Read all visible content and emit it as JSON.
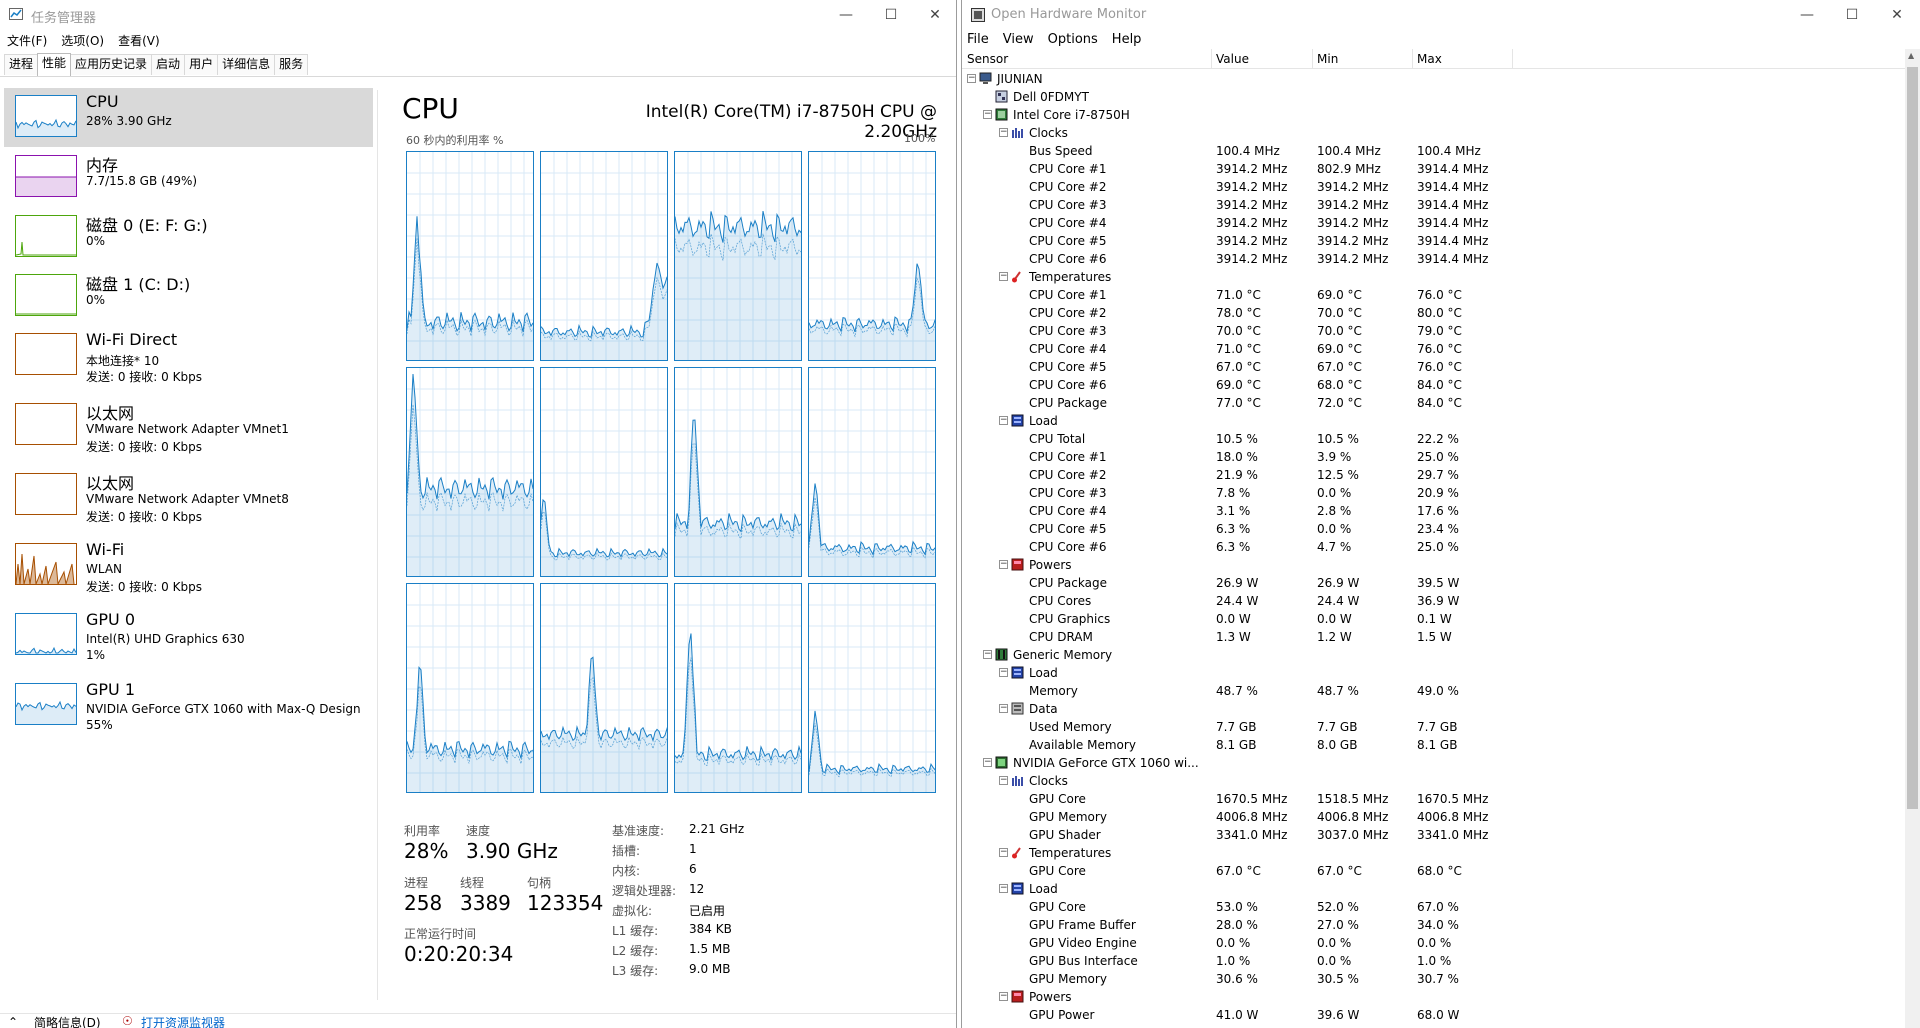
{
  "taskmgr": {
    "title": "任务管理器",
    "menu": [
      "文件(F)",
      "选项(O)",
      "查看(V)"
    ],
    "tabs": [
      "进程",
      "性能",
      "应用历史记录",
      "启动",
      "用户",
      "详细信息",
      "服务"
    ],
    "active_tab": "性能",
    "sidebar": [
      {
        "title": "CPU",
        "l1": "28% 3.90 GHz",
        "l2": "",
        "color": "#1a7fc6",
        "sel": true
      },
      {
        "title": "内存",
        "l1": "7.7/15.8 GB (49%)",
        "l2": "",
        "color": "#8b12ae"
      },
      {
        "title": "磁盘 0 (E: F: G:)",
        "l1": "0%",
        "l2": "",
        "color": "#4da60c"
      },
      {
        "title": "磁盘 1 (C: D:)",
        "l1": "0%",
        "l2": "",
        "color": "#4da60c"
      },
      {
        "title": "Wi-Fi Direct",
        "l1": "本地连接* 10",
        "l2": "发送: 0 接收: 0 Kbps",
        "color": "#a74f01"
      },
      {
        "title": "以太网",
        "l1": "VMware Network Adapter VMnet1",
        "l2": "发送: 0 接收: 0 Kbps",
        "color": "#a74f01"
      },
      {
        "title": "以太网",
        "l1": "VMware Network Adapter VMnet8",
        "l2": "发送: 0 接收: 0 Kbps",
        "color": "#a74f01"
      },
      {
        "title": "Wi-Fi",
        "l1": "WLAN",
        "l2": "发送: 0 接收: 0 Kbps",
        "color": "#a74f01"
      },
      {
        "title": "GPU 0",
        "l1": "Intel(R) UHD Graphics 630",
        "l2": "1%",
        "color": "#1a7fc6"
      },
      {
        "title": "GPU 1",
        "l1": "NVIDIA GeForce GTX 1060 with Max-Q Design",
        "l2": "55%",
        "color": "#1a7fc6"
      }
    ],
    "cpu_title": "CPU",
    "cpu_model": "Intel(R) Core(TM) i7-8750H CPU @ 2.20GHz",
    "util_label": "60 秒内的利用率 %",
    "util_max": "100%",
    "stats": {
      "util_label": "利用率",
      "util": "28%",
      "speed_label": "速度",
      "speed": "3.90 GHz",
      "proc_label": "进程",
      "proc": "258",
      "thread_label": "线程",
      "thread": "3389",
      "handle_label": "句柄",
      "handle": "123354",
      "uptime_label": "正常运行时间",
      "uptime": "0:20:20:34"
    },
    "right_stats": [
      [
        "基准速度:",
        "2.21 GHz"
      ],
      [
        "插槽:",
        "1"
      ],
      [
        "内核:",
        "6"
      ],
      [
        "逻辑处理器:",
        "12"
      ],
      [
        "虚拟化:",
        "已启用"
      ],
      [
        "L1 缓存:",
        "384 KB"
      ],
      [
        "L2 缓存:",
        "1.5 MB"
      ],
      [
        "L3 缓存:",
        "9.0 MB"
      ]
    ],
    "bottom": {
      "less": "简略信息(D)",
      "resmon": "打开资源监视器"
    }
  },
  "ohm": {
    "title": "Open Hardware Monitor",
    "menu": [
      "File",
      "View",
      "Options",
      "Help"
    ],
    "columns": [
      "Sensor",
      "Value",
      "Min",
      "Max"
    ],
    "rows": [
      {
        "l": 0,
        "n": "JIUNIAN",
        "ic": "pc",
        "exp": "-"
      },
      {
        "l": 1,
        "n": "Dell 0FDMYT",
        "ic": "mb"
      },
      {
        "l": 1,
        "n": "Intel Core i7-8750H",
        "ic": "cpu",
        "exp": "-"
      },
      {
        "l": 2,
        "n": "Clocks",
        "ic": "clk",
        "exp": "-"
      },
      {
        "l": 3,
        "n": "Bus Speed",
        "v": "100.4 MHz",
        "mn": "100.4 MHz",
        "mx": "100.4 MHz"
      },
      {
        "l": 3,
        "n": "CPU Core #1",
        "v": "3914.2 MHz",
        "mn": "802.9 MHz",
        "mx": "3914.4 MHz"
      },
      {
        "l": 3,
        "n": "CPU Core #2",
        "v": "3914.2 MHz",
        "mn": "3914.2 MHz",
        "mx": "3914.4 MHz"
      },
      {
        "l": 3,
        "n": "CPU Core #3",
        "v": "3914.2 MHz",
        "mn": "3914.2 MHz",
        "mx": "3914.4 MHz"
      },
      {
        "l": 3,
        "n": "CPU Core #4",
        "v": "3914.2 MHz",
        "mn": "3914.2 MHz",
        "mx": "3914.4 MHz"
      },
      {
        "l": 3,
        "n": "CPU Core #5",
        "v": "3914.2 MHz",
        "mn": "3914.2 MHz",
        "mx": "3914.4 MHz"
      },
      {
        "l": 3,
        "n": "CPU Core #6",
        "v": "3914.2 MHz",
        "mn": "3914.2 MHz",
        "mx": "3914.4 MHz"
      },
      {
        "l": 2,
        "n": "Temperatures",
        "ic": "tmp",
        "exp": "-"
      },
      {
        "l": 3,
        "n": "CPU Core #1",
        "v": "71.0 °C",
        "mn": "69.0 °C",
        "mx": "76.0 °C"
      },
      {
        "l": 3,
        "n": "CPU Core #2",
        "v": "78.0 °C",
        "mn": "70.0 °C",
        "mx": "80.0 °C"
      },
      {
        "l": 3,
        "n": "CPU Core #3",
        "v": "70.0 °C",
        "mn": "70.0 °C",
        "mx": "79.0 °C"
      },
      {
        "l": 3,
        "n": "CPU Core #4",
        "v": "71.0 °C",
        "mn": "69.0 °C",
        "mx": "76.0 °C"
      },
      {
        "l": 3,
        "n": "CPU Core #5",
        "v": "67.0 °C",
        "mn": "67.0 °C",
        "mx": "76.0 °C"
      },
      {
        "l": 3,
        "n": "CPU Core #6",
        "v": "69.0 °C",
        "mn": "68.0 °C",
        "mx": "84.0 °C"
      },
      {
        "l": 3,
        "n": "CPU Package",
        "v": "77.0 °C",
        "mn": "72.0 °C",
        "mx": "84.0 °C"
      },
      {
        "l": 2,
        "n": "Load",
        "ic": "load",
        "exp": "-"
      },
      {
        "l": 3,
        "n": "CPU Total",
        "v": "10.5 %",
        "mn": "10.5 %",
        "mx": "22.2 %"
      },
      {
        "l": 3,
        "n": "CPU Core #1",
        "v": "18.0 %",
        "mn": "3.9 %",
        "mx": "25.0 %"
      },
      {
        "l": 3,
        "n": "CPU Core #2",
        "v": "21.9 %",
        "mn": "12.5 %",
        "mx": "29.7 %"
      },
      {
        "l": 3,
        "n": "CPU Core #3",
        "v": "7.8 %",
        "mn": "0.0 %",
        "mx": "20.9 %"
      },
      {
        "l": 3,
        "n": "CPU Core #4",
        "v": "3.1 %",
        "mn": "2.8 %",
        "mx": "17.6 %"
      },
      {
        "l": 3,
        "n": "CPU Core #5",
        "v": "6.3 %",
        "mn": "0.0 %",
        "mx": "23.4 %"
      },
      {
        "l": 3,
        "n": "CPU Core #6",
        "v": "6.3 %",
        "mn": "4.7 %",
        "mx": "25.0 %"
      },
      {
        "l": 2,
        "n": "Powers",
        "ic": "pwr",
        "exp": "-"
      },
      {
        "l": 3,
        "n": "CPU Package",
        "v": "26.9 W",
        "mn": "26.9 W",
        "mx": "39.5 W"
      },
      {
        "l": 3,
        "n": "CPU Cores",
        "v": "24.4 W",
        "mn": "24.4 W",
        "mx": "36.9 W"
      },
      {
        "l": 3,
        "n": "CPU Graphics",
        "v": "0.0 W",
        "mn": "0.0 W",
        "mx": "0.1 W"
      },
      {
        "l": 3,
        "n": "CPU DRAM",
        "v": "1.3 W",
        "mn": "1.2 W",
        "mx": "1.5 W"
      },
      {
        "l": 1,
        "n": "Generic Memory",
        "ic": "ram",
        "exp": "-"
      },
      {
        "l": 2,
        "n": "Load",
        "ic": "load",
        "exp": "-"
      },
      {
        "l": 3,
        "n": "Memory",
        "v": "48.7 %",
        "mn": "48.7 %",
        "mx": "49.0 %"
      },
      {
        "l": 2,
        "n": "Data",
        "ic": "data",
        "exp": "-"
      },
      {
        "l": 3,
        "n": "Used Memory",
        "v": "7.7 GB",
        "mn": "7.7 GB",
        "mx": "7.7 GB"
      },
      {
        "l": 3,
        "n": "Available Memory",
        "v": "8.1 GB",
        "mn": "8.0 GB",
        "mx": "8.1 GB"
      },
      {
        "l": 1,
        "n": "NVIDIA GeForce GTX 1060 wi...",
        "ic": "gpu",
        "exp": "-"
      },
      {
        "l": 2,
        "n": "Clocks",
        "ic": "clk",
        "exp": "-"
      },
      {
        "l": 3,
        "n": "GPU Core",
        "v": "1670.5 MHz",
        "mn": "1518.5 MHz",
        "mx": "1670.5 MHz"
      },
      {
        "l": 3,
        "n": "GPU Memory",
        "v": "4006.8 MHz",
        "mn": "4006.8 MHz",
        "mx": "4006.8 MHz"
      },
      {
        "l": 3,
        "n": "GPU Shader",
        "v": "3341.0 MHz",
        "mn": "3037.0 MHz",
        "mx": "3341.0 MHz"
      },
      {
        "l": 2,
        "n": "Temperatures",
        "ic": "tmp",
        "exp": "-"
      },
      {
        "l": 3,
        "n": "GPU Core",
        "v": "67.0 °C",
        "mn": "67.0 °C",
        "mx": "68.0 °C"
      },
      {
        "l": 2,
        "n": "Load",
        "ic": "load",
        "exp": "-"
      },
      {
        "l": 3,
        "n": "GPU Core",
        "v": "53.0 %",
        "mn": "52.0 %",
        "mx": "67.0 %"
      },
      {
        "l": 3,
        "n": "GPU Frame Buffer",
        "v": "28.0 %",
        "mn": "27.0 %",
        "mx": "34.0 %"
      },
      {
        "l": 3,
        "n": "GPU Video Engine",
        "v": "0.0 %",
        "mn": "0.0 %",
        "mx": "0.0 %"
      },
      {
        "l": 3,
        "n": "GPU Bus Interface",
        "v": "1.0 %",
        "mn": "0.0 %",
        "mx": "1.0 %"
      },
      {
        "l": 3,
        "n": "GPU Memory",
        "v": "30.6 %",
        "mn": "30.5 %",
        "mx": "30.7 %"
      },
      {
        "l": 2,
        "n": "Powers",
        "ic": "pwr",
        "exp": "-"
      },
      {
        "l": 3,
        "n": "GPU Power",
        "v": "41.0 W",
        "mn": "39.6 W",
        "mx": "68.0 W"
      }
    ]
  }
}
